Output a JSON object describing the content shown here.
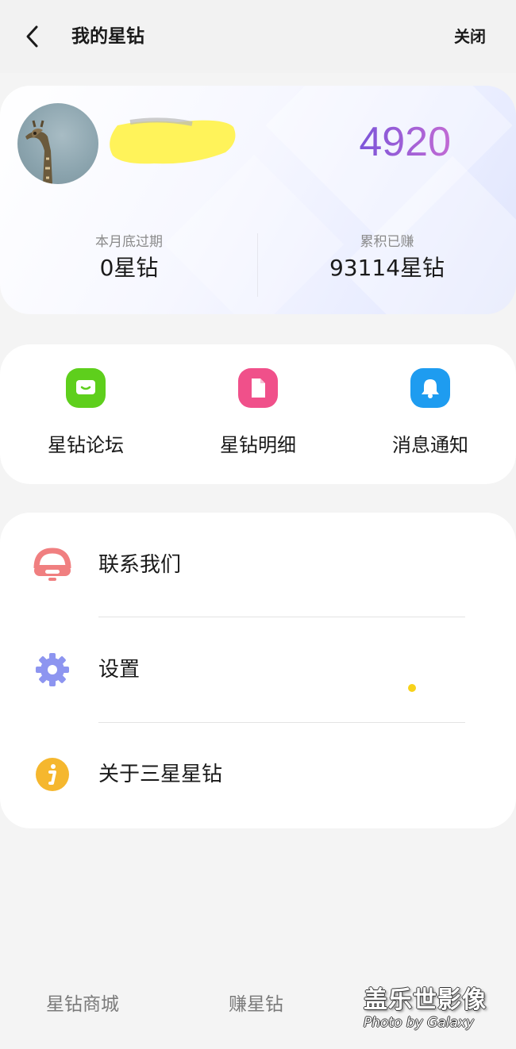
{
  "header": {
    "title": "我的星钻",
    "close_label": "关闭",
    "back_icon": "chevron-left-icon"
  },
  "balance": {
    "value": "4920",
    "gradient_start": "#7c55d9",
    "gradient_end": "#c16ad4",
    "stats": [
      {
        "label": "本月底过期",
        "value": "0星钻"
      },
      {
        "label": "累积已赚",
        "value": "93114星钻"
      }
    ]
  },
  "shortcuts": [
    {
      "label": "星钻论坛",
      "icon": "chat-icon",
      "color": "#5ecf1c"
    },
    {
      "label": "星钻明细",
      "icon": "document-icon",
      "color": "#f0508a"
    },
    {
      "label": "消息通知",
      "icon": "bell-icon",
      "color": "#1e9cf0"
    }
  ],
  "menu": [
    {
      "label": "联系我们",
      "icon": "headset-icon",
      "color": "#f07f80"
    },
    {
      "label": "设置",
      "icon": "gear-icon",
      "color": "#8d95f0"
    },
    {
      "label": "关于三星星钻",
      "icon": "info-icon",
      "color": "#f5b72e"
    }
  ],
  "bottom_nav": [
    {
      "label": "星钻商城"
    },
    {
      "label": "赚星钻"
    }
  ],
  "watermark": {
    "main": "盖乐世影像",
    "sub": "Photo by Galaxy"
  }
}
